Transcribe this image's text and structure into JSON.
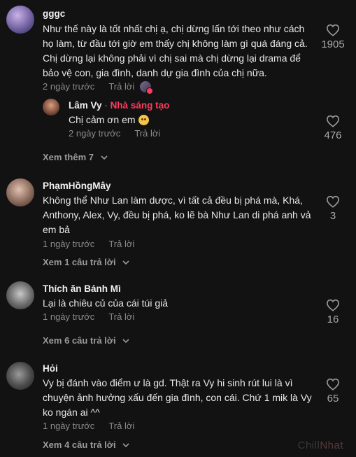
{
  "comments": [
    {
      "author": "gggc",
      "text": "Như thế này là tốt nhất chị ạ, chị dừng lấn tới theo như cách họ làm, từ đầu tới giờ em thấy chị không làm gì quá đáng cả. Chị dừng lại không phải vì chị sai mà chị dừng lại drama để bảo vệ con, gia đình, danh dự gia đình của chị nữa.",
      "time": "2 ngày trước",
      "reply_label": "Trả lời",
      "likes": "1905"
    },
    {
      "author": "PhạmHồngMây",
      "text": "Không thể Như Lan làm dược, vì tất cả đều bị phá mà, Khá, Anthony, Alex, Vy, đều bị phá, ko lẽ bà Như Lan di phá anh vả em bả",
      "time": "1 ngày trước",
      "reply_label": "Trả lời",
      "likes": "3",
      "more_label": "Xem 1 câu trả lời"
    },
    {
      "author": "Thích ăn Bánh Mì",
      "text": "Lại là chiêu củ của cái túi giả",
      "time": "1 ngày trước",
      "reply_label": "Trả lời",
      "likes": "16",
      "more_label": "Xem 6 câu trả lời"
    },
    {
      "author": "Hỏi",
      "text": "Vy bị đánh vào điểm ư là gd. Thật ra Vy hi sinh rút lui là vì chuyện ảnh hưởng xấu đến gia đình, con cái. Chứ 1 mik là Vy ko ngán ai ^^",
      "time": "1 ngày trước",
      "reply_label": "Trả lời",
      "likes": "65",
      "more_label": "Xem 4 câu trả lời"
    }
  ],
  "reply": {
    "author": "Lâm Vy",
    "separator": "·",
    "creator_badge": "Nhà sáng tạo",
    "text": "Chị cảm ơn em",
    "time": "2 ngày trước",
    "reply_label": "Trả lời",
    "likes": "476"
  },
  "first_thread_more": "Xem thêm 7",
  "watermark": {
    "part1": "Chill",
    "part2": "Nhat"
  },
  "icons": {
    "like": "heart-outline-icon",
    "expand": "chevron-down-icon"
  }
}
